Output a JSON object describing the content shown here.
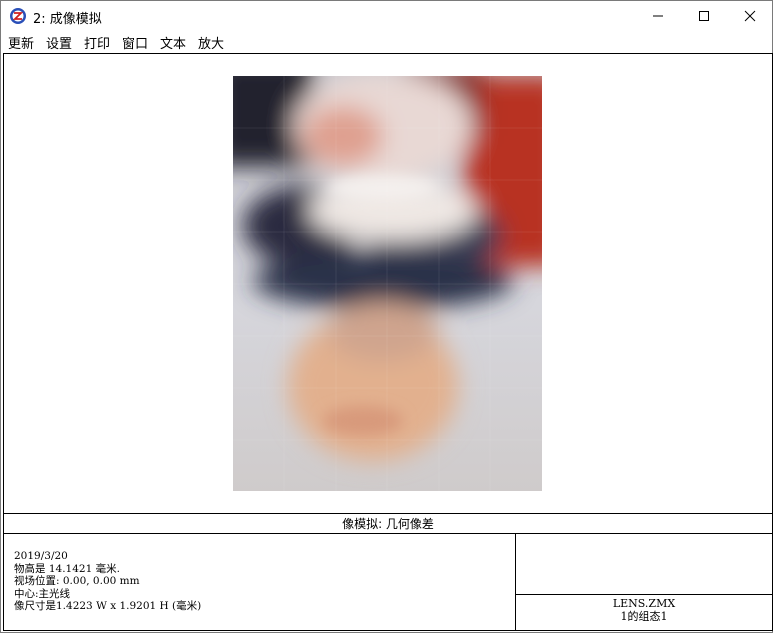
{
  "window": {
    "title": "2: 成像模拟",
    "app_icon": "zemax-app-icon",
    "controls": [
      "minimize-icon",
      "maximize-icon",
      "close-icon"
    ]
  },
  "menu": {
    "items": [
      {
        "label": "更新"
      },
      {
        "label": "设置"
      },
      {
        "label": "打印"
      },
      {
        "label": "窗口"
      },
      {
        "label": "文本"
      },
      {
        "label": "放大"
      }
    ]
  },
  "plot": {
    "title": "像模拟: 几何像差"
  },
  "info": {
    "lines": [
      "2019/3/20",
      "物高是 14.1421 毫米.",
      "视场位置: 0.00, 0.00 mm",
      "中心:主光线",
      "像尺寸是1.4223 W x 1.9201 H (毫米)"
    ],
    "lens_file": "LENS.ZMX",
    "config": "1的组态1"
  },
  "colors": {
    "border": "#000000",
    "title_bar_bg": "#ffffff"
  }
}
